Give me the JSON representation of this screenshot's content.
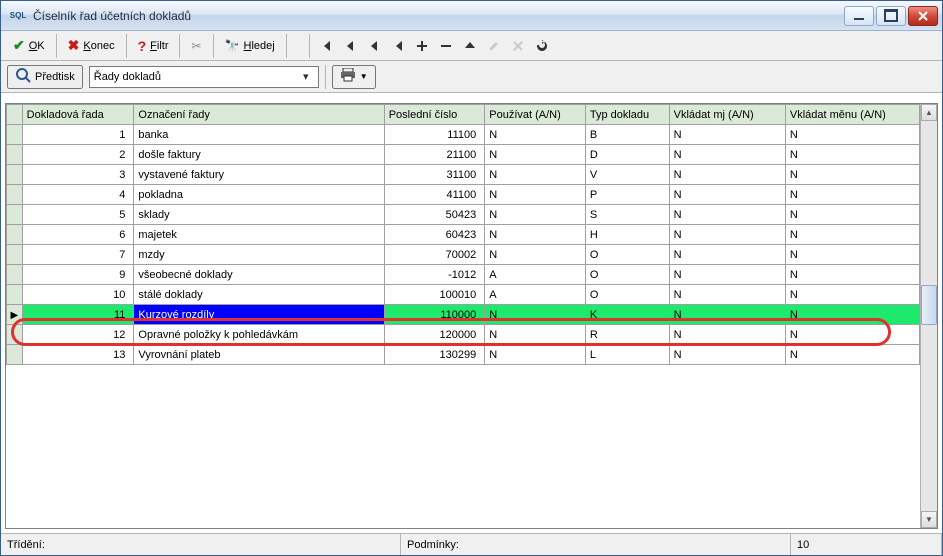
{
  "title": "Číselník řad účetních dokladů",
  "toolbar": {
    "ok": "OK",
    "konec": "Konec",
    "filtr": "Filtr",
    "hledej": "Hledej"
  },
  "toolbar2": {
    "predtisk": "Předtisk",
    "combo_value": "Řady dokladů"
  },
  "columns": {
    "rada": "Dokladová řada",
    "oznaceni": "Označení řady",
    "cislo": "Poslední číslo",
    "pouzivat": "Používat (A/N)",
    "typ": "Typ dokladu",
    "mj": "Vkládat mj (A/N)",
    "mena": "Vkládat měnu (A/N)"
  },
  "rows": [
    {
      "rada": "1",
      "ozn": "banka",
      "cislo": "11100",
      "pouz": "N",
      "typ": "B",
      "mj": "N",
      "mena": "N"
    },
    {
      "rada": "2",
      "ozn": "došle faktury",
      "cislo": "21100",
      "pouz": "N",
      "typ": "D",
      "mj": "N",
      "mena": "N"
    },
    {
      "rada": "3",
      "ozn": "vystavené faktury",
      "cislo": "31100",
      "pouz": "N",
      "typ": "V",
      "mj": "N",
      "mena": "N"
    },
    {
      "rada": "4",
      "ozn": "pokladna",
      "cislo": "41100",
      "pouz": "N",
      "typ": "P",
      "mj": "N",
      "mena": "N"
    },
    {
      "rada": "5",
      "ozn": "sklady",
      "cislo": "50423",
      "pouz": "N",
      "typ": "S",
      "mj": "N",
      "mena": "N"
    },
    {
      "rada": "6",
      "ozn": "majetek",
      "cislo": "60423",
      "pouz": "N",
      "typ": "H",
      "mj": "N",
      "mena": "N"
    },
    {
      "rada": "7",
      "ozn": "mzdy",
      "cislo": "70002",
      "pouz": "N",
      "typ": "O",
      "mj": "N",
      "mena": "N"
    },
    {
      "rada": "9",
      "ozn": "všeobecné doklady",
      "cislo": "-1012",
      "pouz": "A",
      "typ": "O",
      "mj": "N",
      "mena": "N"
    },
    {
      "rada": "10",
      "ozn": "stálé doklady",
      "cislo": "100010",
      "pouz": "A",
      "typ": "O",
      "mj": "N",
      "mena": "N"
    },
    {
      "rada": "11",
      "ozn": "Kurzové rozdíly",
      "cislo": "110000",
      "pouz": "N",
      "typ": "K",
      "mj": "N",
      "mena": "N",
      "selected": true
    },
    {
      "rada": "12",
      "ozn": "Opravné položky k pohledávkám",
      "cislo": "120000",
      "pouz": "N",
      "typ": "R",
      "mj": "N",
      "mena": "N"
    },
    {
      "rada": "13",
      "ozn": "Vyrovnání plateb",
      "cislo": "130299",
      "pouz": "N",
      "typ": "L",
      "mj": "N",
      "mena": "N"
    }
  ],
  "status": {
    "trideni_label": "Třídění:",
    "podminky_label": "Podmínky:",
    "count": "10"
  }
}
